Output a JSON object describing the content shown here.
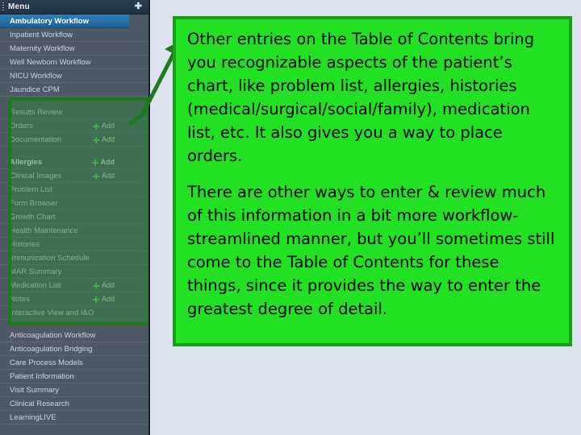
{
  "sidebar": {
    "header": {
      "title": "Menu",
      "pin_icon": "pin-icon",
      "grip_icon": "grip-handle-icon"
    },
    "items": [
      {
        "label": "Ambulatory Workflow",
        "selected": true,
        "add": false,
        "gap_before": false,
        "header_row": false
      },
      {
        "label": "Inpatient Workflow",
        "selected": false,
        "add": false,
        "gap_before": false,
        "header_row": false
      },
      {
        "label": "Maternity Workflow",
        "selected": false,
        "add": false,
        "gap_before": false,
        "header_row": false
      },
      {
        "label": "Well Newborn Workflow",
        "selected": false,
        "add": false,
        "gap_before": false,
        "header_row": false
      },
      {
        "label": "NICU Workflow",
        "selected": false,
        "add": false,
        "gap_before": false,
        "header_row": false
      },
      {
        "label": "Jaundice CPM",
        "selected": false,
        "add": false,
        "gap_before": false,
        "header_row": false
      },
      {
        "label": "Results Review",
        "selected": false,
        "add": false,
        "gap_before": true,
        "header_row": false
      },
      {
        "label": "Orders",
        "selected": false,
        "add": true,
        "gap_before": false,
        "header_row": false
      },
      {
        "label": "Documentation",
        "selected": false,
        "add": true,
        "gap_before": false,
        "header_row": false
      },
      {
        "label": "Allergies",
        "selected": false,
        "add": true,
        "gap_before": true,
        "header_row": true
      },
      {
        "label": "Clinical Images",
        "selected": false,
        "add": true,
        "gap_before": false,
        "header_row": false
      },
      {
        "label": "Problem List",
        "selected": false,
        "add": false,
        "gap_before": false,
        "header_row": false
      },
      {
        "label": "Form Browser",
        "selected": false,
        "add": false,
        "gap_before": false,
        "header_row": false
      },
      {
        "label": "Growth Chart",
        "selected": false,
        "add": false,
        "gap_before": false,
        "header_row": false
      },
      {
        "label": "Health Maintenance",
        "selected": false,
        "add": false,
        "gap_before": false,
        "header_row": false
      },
      {
        "label": "Histories",
        "selected": false,
        "add": false,
        "gap_before": false,
        "header_row": false
      },
      {
        "label": "Immunization Schedule",
        "selected": false,
        "add": false,
        "gap_before": false,
        "header_row": false
      },
      {
        "label": "MAR Summary",
        "selected": false,
        "add": false,
        "gap_before": false,
        "header_row": false
      },
      {
        "label": "Medication List",
        "selected": false,
        "add": true,
        "gap_before": false,
        "header_row": false
      },
      {
        "label": "Notes",
        "selected": false,
        "add": true,
        "gap_before": false,
        "header_row": false
      },
      {
        "label": "Interactive View and I&O",
        "selected": false,
        "add": false,
        "gap_before": false,
        "header_row": false
      },
      {
        "label": "Anticoagulation Workflow",
        "selected": false,
        "add": false,
        "gap_before": true,
        "header_row": false
      },
      {
        "label": "Anticoagulation Bridging",
        "selected": false,
        "add": false,
        "gap_before": false,
        "header_row": false
      },
      {
        "label": "Care Process Models",
        "selected": false,
        "add": false,
        "gap_before": false,
        "header_row": false
      },
      {
        "label": "Patient Information",
        "selected": false,
        "add": false,
        "gap_before": false,
        "header_row": false
      },
      {
        "label": "Visit Summary",
        "selected": false,
        "add": false,
        "gap_before": false,
        "header_row": false
      },
      {
        "label": "Clinical Research",
        "selected": false,
        "add": false,
        "gap_before": false,
        "header_row": false
      },
      {
        "label": "LearningLIVE",
        "selected": false,
        "add": false,
        "gap_before": false,
        "header_row": false
      }
    ],
    "add_label": "Add",
    "add_icon": "plus-icon"
  },
  "annotation": {
    "highlight_box": {
      "name": "menu-section-highlight",
      "color": "#1d7a1d"
    },
    "arrow": {
      "name": "green-arrow",
      "color": "#1d7a1d"
    },
    "callout": {
      "background_color": "#22e022",
      "border_color": "#17a017",
      "paragraphs": [
        "Other entries on the Table of Contents bring you recognizable aspects of the patient’s chart, like problem list, allergies, histories (medical/surgical/social/family), medication list, etc.  It also gives you a way to place orders.",
        "There are other ways to enter & review much of this information in a bit more workflow-streamlined manner, but you’ll sometimes still come to the Table of Contents for these things, since it provides the way to enter the greatest degree of detail."
      ]
    }
  }
}
